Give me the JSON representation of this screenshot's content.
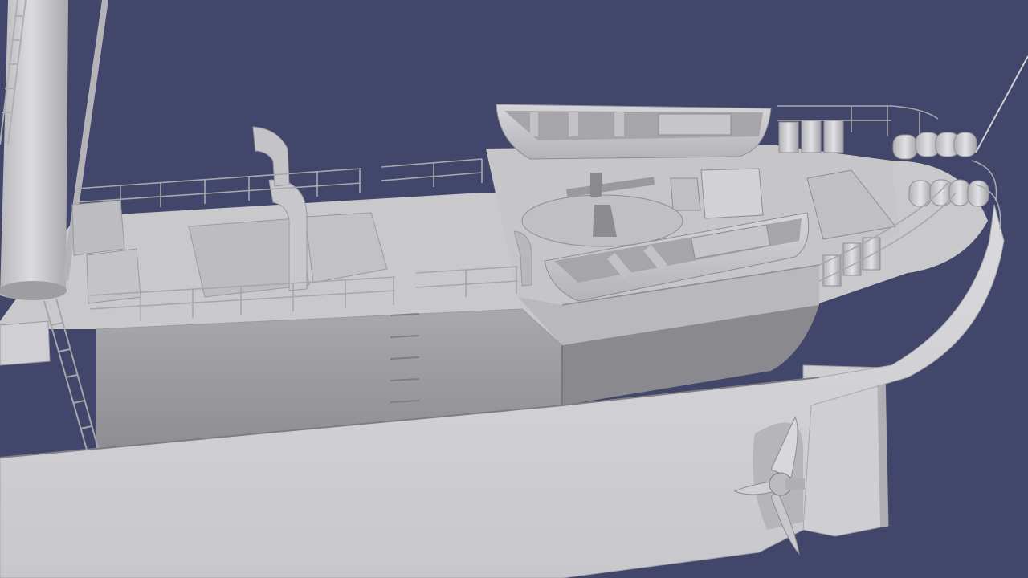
{
  "scene": {
    "subject": "ship-stern-3d-render",
    "colors": {
      "background": "#42466b",
      "hull_light": "#d3d3d7",
      "hull_mid": "#bdbdc1",
      "hull_shadow": "#9a9a9e",
      "deck": "#cacacc",
      "line": "#8a8a8e",
      "dark": "#6e6e72"
    }
  }
}
